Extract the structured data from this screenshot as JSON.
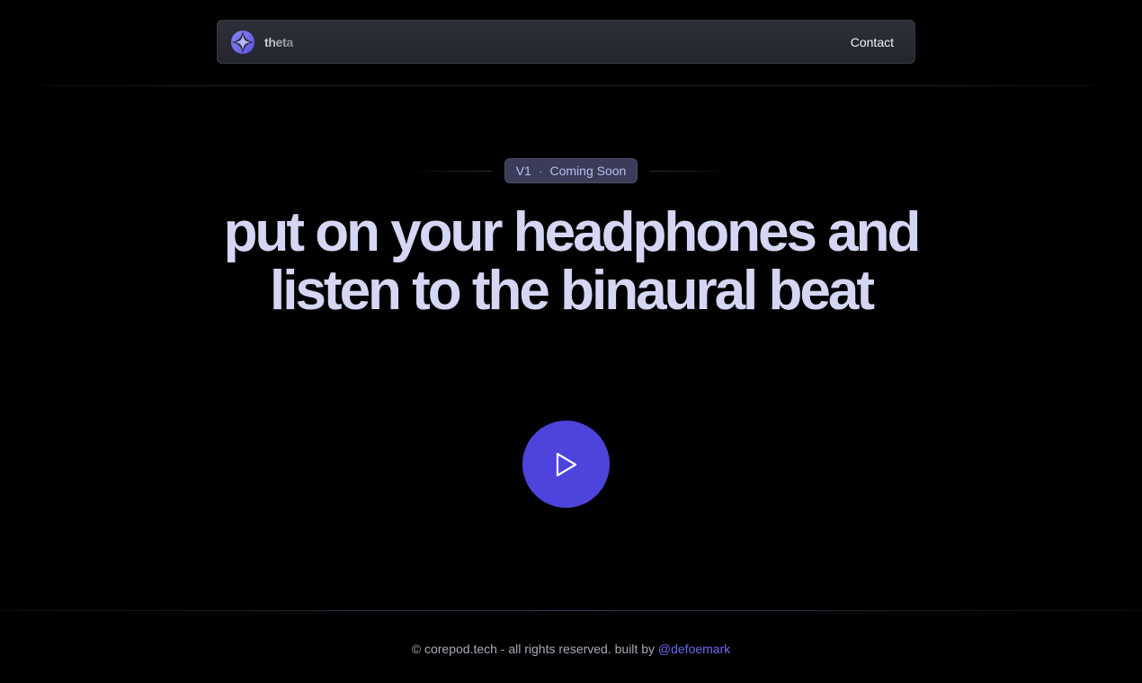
{
  "navbar": {
    "brand_name": "theta",
    "contact_label": "Contact"
  },
  "hero": {
    "badge_version": "V1",
    "badge_separator": "·",
    "badge_status": "Coming Soon",
    "headline": "put on your headphones and listen to the binaural beat",
    "play_icon": "play-icon"
  },
  "footer": {
    "copyright": "© corepod.tech - all rights reserved. built by",
    "author_link": "@defoemark"
  },
  "colors": {
    "background": "#000000",
    "accent": "#4d44db",
    "headline": "#d4d6f4",
    "badge_bg": "#3b3d58",
    "link": "#6d68f2"
  }
}
